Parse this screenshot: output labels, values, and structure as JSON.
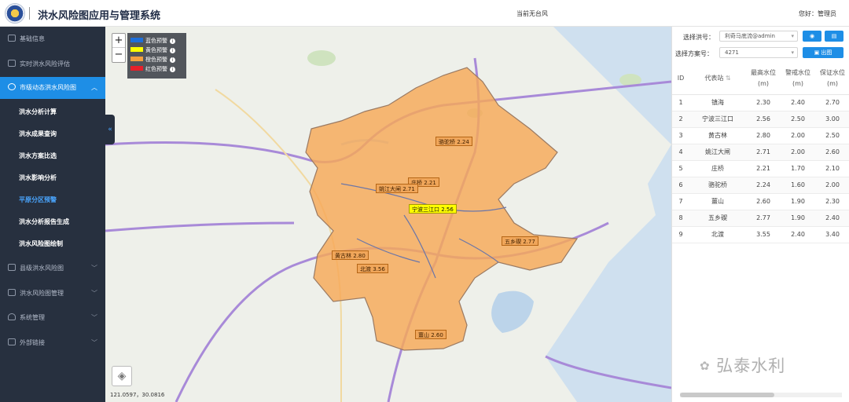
{
  "header": {
    "title": "洪水风险图应用与管理系统",
    "typhoon_status": "当前无台风",
    "user_greeting": "您好：管理员"
  },
  "sidebar": {
    "items": [
      {
        "label": "基础信息",
        "icon": "grid-icon"
      },
      {
        "label": "实时洪水风险评估",
        "icon": "monitor-icon"
      },
      {
        "label": "市级动态洪水风险图",
        "icon": "globe-icon",
        "active": true
      },
      {
        "label": "县级洪水风险图",
        "icon": "layers-icon"
      },
      {
        "label": "洪水风险图管理",
        "icon": "folder-icon"
      },
      {
        "label": "系统管理",
        "icon": "user-icon"
      },
      {
        "label": "外部链接",
        "icon": "link-icon"
      }
    ],
    "sub_items": [
      {
        "label": "洪水分析计算"
      },
      {
        "label": "洪水成果查询"
      },
      {
        "label": "洪水方案比选"
      },
      {
        "label": "洪水影响分析"
      },
      {
        "label": "平原分区预警",
        "active": true
      },
      {
        "label": "洪水分析报告生成"
      },
      {
        "label": "洪水风险图绘制"
      }
    ],
    "collapse_icon": "double-chevron-left-icon"
  },
  "map": {
    "zoom_in": "+",
    "zoom_out": "−",
    "legend": [
      {
        "label": "蓝色预警",
        "color": "#1e6fd9"
      },
      {
        "label": "黄色预警",
        "color": "#ffff00"
      },
      {
        "label": "橙色预警",
        "color": "#f5a040"
      },
      {
        "label": "红色预警",
        "color": "#e8202a"
      }
    ],
    "stations": [
      {
        "label": "骆驼桥 2.24",
        "level": "orange"
      },
      {
        "label": "庄桥 2.21",
        "level": "orange"
      },
      {
        "label": "姚江大闸 2.71",
        "level": "orange"
      },
      {
        "label": "宁波三江口 2.56",
        "level": "yellow"
      },
      {
        "label": "五乡碶 2.77",
        "level": "orange"
      },
      {
        "label": "黄古林 2.80",
        "level": "orange"
      },
      {
        "label": "北渡 3.56",
        "level": "orange"
      },
      {
        "label": "薑山 2.60",
        "level": "orange"
      }
    ],
    "coordinates": "121.0597，30.0816",
    "layers_icon": "layers-icon"
  },
  "panel": {
    "flood_label": "选择洪号：",
    "flood_value": "利奇马底流@admin",
    "scheme_label": "选择方案号：",
    "scheme_value": "4271",
    "view_icon": "eye-icon",
    "doc_icon": "document-icon",
    "export_label": "出图",
    "columns": [
      "ID",
      "代表站",
      "最高水位\n(m)",
      "警戒水位\n(m)",
      "保证水位\n(m)"
    ],
    "rows": [
      [
        "1",
        "镇海",
        "2.30",
        "2.40",
        "2.70"
      ],
      [
        "2",
        "宁波三江口",
        "2.56",
        "2.50",
        "3.00"
      ],
      [
        "3",
        "黄古林",
        "2.80",
        "2.00",
        "2.50"
      ],
      [
        "4",
        "姚江大闸",
        "2.71",
        "2.00",
        "2.60"
      ],
      [
        "5",
        "庄桥",
        "2.21",
        "1.70",
        "2.10"
      ],
      [
        "6",
        "骆驼桥",
        "2.24",
        "1.60",
        "2.00"
      ],
      [
        "7",
        "薑山",
        "2.60",
        "1.90",
        "2.30"
      ],
      [
        "8",
        "五乡碶",
        "2.77",
        "1.90",
        "2.40"
      ],
      [
        "9",
        "北渡",
        "3.55",
        "2.40",
        "3.40"
      ]
    ]
  },
  "watermark": "弘泰水利"
}
